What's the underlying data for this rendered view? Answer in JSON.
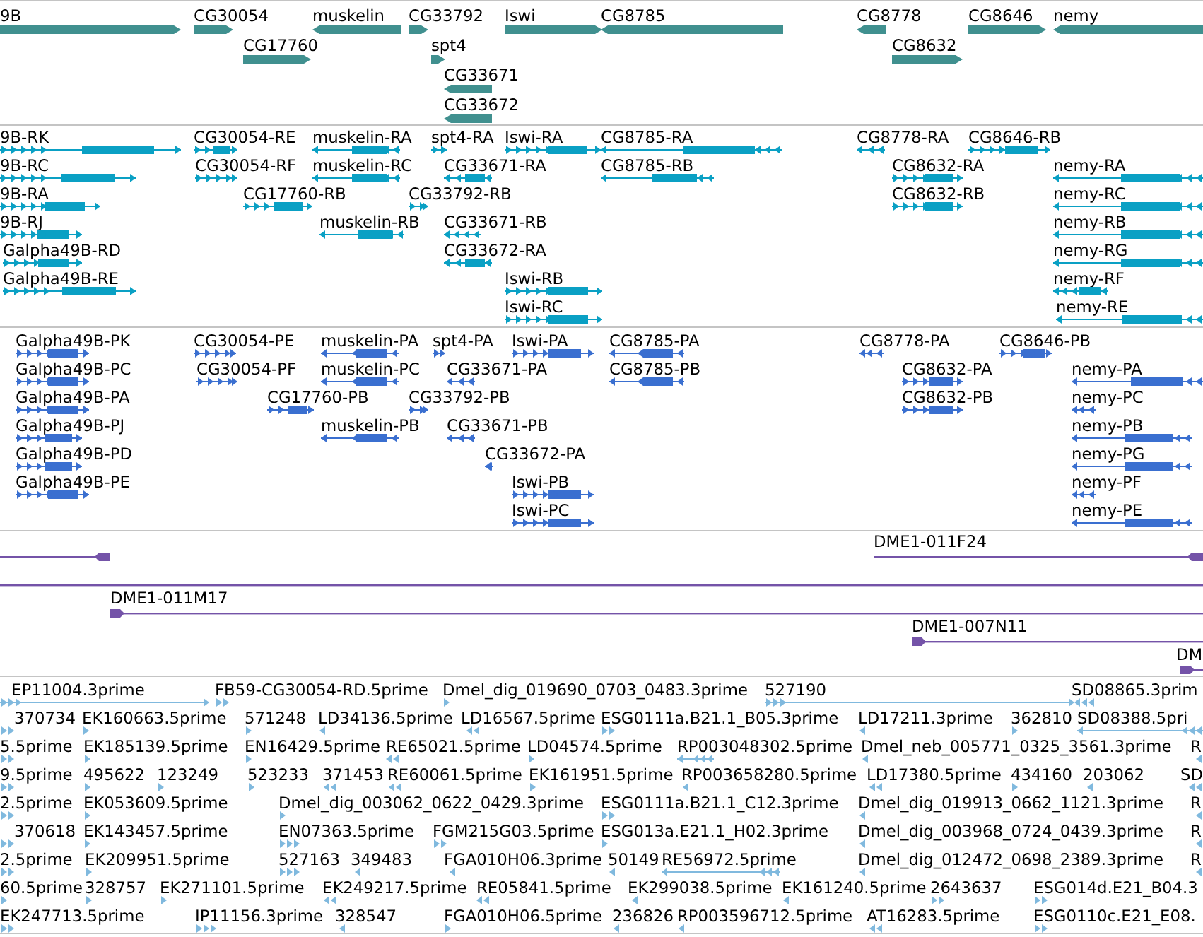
{
  "tracks": [
    {
      "kind": "gene",
      "rows": [
        {
          "features": [
            {
              "label": "9B",
              "reverse": false
            },
            {
              "label": "CG30054",
              "reverse": false
            },
            {
              "label": "muskelin",
              "reverse": true
            },
            {
              "label": "CG33792",
              "reverse": false
            },
            {
              "label": "Iswi",
              "reverse": false
            },
            {
              "label": "CG8785",
              "reverse": true
            },
            {
              "label": "CG8778",
              "reverse": true
            },
            {
              "label": "CG8646",
              "reverse": false
            },
            {
              "label": "nemy",
              "reverse": true
            }
          ]
        },
        {
          "features": [
            {
              "label": "CG17760",
              "reverse": false
            },
            {
              "label": "spt4",
              "reverse": false
            },
            {
              "label": "CG8632",
              "reverse": false
            }
          ]
        },
        {
          "features": [
            {
              "label": "CG33671",
              "reverse": true
            }
          ]
        },
        {
          "features": [
            {
              "label": "CG33672",
              "reverse": true
            }
          ]
        }
      ]
    },
    {
      "kind": "transcript",
      "rows": [
        {
          "features": [
            {
              "label": "9B-RK",
              "reverse": false
            },
            {
              "label": "CG30054-RE",
              "reverse": false
            },
            {
              "label": "muskelin-RA",
              "reverse": true
            },
            {
              "label": "spt4-RA",
              "reverse": false
            },
            {
              "label": "Iswi-RA",
              "reverse": false
            },
            {
              "label": "CG8785-RA",
              "reverse": true
            },
            {
              "label": "CG8778-RA",
              "reverse": true
            },
            {
              "label": "CG8646-RB",
              "reverse": false
            }
          ]
        },
        {
          "features": [
            {
              "label": "9B-RC",
              "reverse": false
            },
            {
              "label": "CG30054-RF",
              "reverse": false
            },
            {
              "label": "muskelin-RC",
              "reverse": true
            },
            {
              "label": "CG33671-RA",
              "reverse": true
            },
            {
              "label": "CG8785-RB",
              "reverse": true
            },
            {
              "label": "CG8632-RA",
              "reverse": false
            },
            {
              "label": "nemy-RA",
              "reverse": true
            }
          ]
        },
        {
          "features": [
            {
              "label": "9B-RA",
              "reverse": false
            },
            {
              "label": "CG17760-RB",
              "reverse": false
            },
            {
              "label": "CG33792-RB",
              "reverse": false
            },
            {
              "label": "CG8632-RB",
              "reverse": false
            },
            {
              "label": "nemy-RC",
              "reverse": true
            }
          ]
        },
        {
          "features": [
            {
              "label": "9B-RJ",
              "reverse": false
            },
            {
              "label": "muskelin-RB",
              "reverse": true
            },
            {
              "label": "CG33671-RB",
              "reverse": true
            },
            {
              "label": "nemy-RB",
              "reverse": true
            }
          ]
        },
        {
          "features": [
            {
              "label": "Galpha49B-RD",
              "reverse": false
            },
            {
              "label": "CG33672-RA",
              "reverse": true
            },
            {
              "label": "nemy-RG",
              "reverse": true
            }
          ]
        },
        {
          "features": [
            {
              "label": "Galpha49B-RE",
              "reverse": false
            },
            {
              "label": "Iswi-RB",
              "reverse": false
            },
            {
              "label": "nemy-RF",
              "reverse": true
            }
          ]
        },
        {
          "features": [
            {
              "label": "Iswi-RC",
              "reverse": false
            },
            {
              "label": "nemy-RE",
              "reverse": true
            }
          ]
        }
      ]
    },
    {
      "kind": "protein",
      "rows": [
        {
          "features": [
            {
              "label": "Galpha49B-PK",
              "reverse": false
            },
            {
              "label": "CG30054-PE",
              "reverse": false
            },
            {
              "label": "muskelin-PA",
              "reverse": true
            },
            {
              "label": "spt4-PA",
              "reverse": false
            },
            {
              "label": "Iswi-PA",
              "reverse": false
            },
            {
              "label": "CG8785-PA",
              "reverse": true
            },
            {
              "label": "CG8778-PA",
              "reverse": true
            },
            {
              "label": "CG8646-PB",
              "reverse": false
            }
          ]
        },
        {
          "features": [
            {
              "label": "Galpha49B-PC",
              "reverse": false
            },
            {
              "label": "CG30054-PF",
              "reverse": false
            },
            {
              "label": "muskelin-PC",
              "reverse": true
            },
            {
              "label": "CG33671-PA",
              "reverse": true
            },
            {
              "label": "CG8785-PB",
              "reverse": true
            },
            {
              "label": "CG8632-PA",
              "reverse": false
            },
            {
              "label": "nemy-PA",
              "reverse": true
            }
          ]
        },
        {
          "features": [
            {
              "label": "Galpha49B-PA",
              "reverse": false
            },
            {
              "label": "CG17760-PB",
              "reverse": false
            },
            {
              "label": "CG33792-PB",
              "reverse": false
            },
            {
              "label": "CG8632-PB",
              "reverse": false
            },
            {
              "label": "nemy-PC",
              "reverse": true
            }
          ]
        },
        {
          "features": [
            {
              "label": "Galpha49B-PJ",
              "reverse": false
            },
            {
              "label": "muskelin-PB",
              "reverse": true
            },
            {
              "label": "CG33671-PB",
              "reverse": true
            },
            {
              "label": "nemy-PB",
              "reverse": true
            }
          ]
        },
        {
          "features": [
            {
              "label": "Galpha49B-PD",
              "reverse": false
            },
            {
              "label": "CG33672-PA",
              "reverse": true
            },
            {
              "label": "nemy-PG",
              "reverse": true
            }
          ]
        },
        {
          "features": [
            {
              "label": "Galpha49B-PE",
              "reverse": false
            },
            {
              "label": "Iswi-PB",
              "reverse": false
            },
            {
              "label": "nemy-PF",
              "reverse": true
            }
          ]
        },
        {
          "features": [
            {
              "label": "Iswi-PC",
              "reverse": false
            },
            {
              "label": "nemy-PE",
              "reverse": true
            }
          ]
        }
      ]
    },
    {
      "kind": "clone",
      "rows": [
        {
          "features": [
            {
              "reverse": true
            },
            {
              "label": "DME1-011F24",
              "reverse": true
            }
          ]
        },
        {
          "features": [
            {
              "reverse": false
            }
          ]
        },
        {
          "features": [
            {
              "label": "DME1-011M17",
              "reverse": false
            }
          ]
        },
        {
          "features": [
            {
              "label": "DME1-007N11",
              "reverse": false
            }
          ]
        },
        {
          "features": [
            {
              "label": "DM",
              "reverse": false
            }
          ]
        }
      ]
    },
    {
      "kind": "est",
      "rows": [
        {
          "features": [
            {
              "label": "EP11004.3prime",
              "reverse": false
            },
            {
              "label": "FB59-CG30054-RD.5prime",
              "reverse": false
            },
            {
              "label": "Dmel_dig_019690_0703_0483.3prime",
              "reverse": false
            },
            {
              "label": "527190",
              "reverse": false
            },
            {
              "label": "SD08865.3prim",
              "reverse": true
            }
          ]
        },
        {
          "features": [
            {
              "label": "370734",
              "reverse": false
            },
            {
              "label": "EK160663.5prime",
              "reverse": false
            },
            {
              "label": "571248",
              "reverse": false
            },
            {
              "label": "LD34136.5prime",
              "reverse": true
            },
            {
              "label": "LD16567.5prime",
              "reverse": true
            },
            {
              "label": "ESG0111a.B21.1_B05.3prime",
              "reverse": false
            },
            {
              "label": "LD17211.3prime",
              "reverse": true
            },
            {
              "label": "362810",
              "reverse": false
            },
            {
              "label": "SD08388.5pri",
              "reverse": true
            }
          ]
        },
        {
          "features": [
            {
              "label": "5.5prime",
              "reverse": false
            },
            {
              "label": "EK185139.5prime",
              "reverse": false
            },
            {
              "label": "EN16429.5prime",
              "reverse": false
            },
            {
              "label": "RE65021.5prime",
              "reverse": true
            },
            {
              "label": "LD04574.5prime",
              "reverse": false
            },
            {
              "label": "RP003048302.5prime",
              "reverse": true
            },
            {
              "label": "Dmel_neb_005771_0325_3561.3prime",
              "reverse": true
            },
            {
              "label": "R",
              "reverse": true
            }
          ]
        },
        {
          "features": [
            {
              "label": "9.5prime",
              "reverse": false
            },
            {
              "label": "495622",
              "reverse": false
            },
            {
              "label": "123249",
              "reverse": false
            },
            {
              "label": "523233",
              "reverse": false
            },
            {
              "label": "371453",
              "reverse": true
            },
            {
              "label": "RE60061.5prime",
              "reverse": true
            },
            {
              "label": "EK161951.5prime",
              "reverse": false
            },
            {
              "label": "RP003658280.5prime",
              "reverse": true
            },
            {
              "label": "LD17380.5prime",
              "reverse": true
            },
            {
              "label": "434160",
              "reverse": false
            },
            {
              "label": "203062",
              "reverse": true
            },
            {
              "label": "SD",
              "reverse": true
            }
          ]
        },
        {
          "features": [
            {
              "label": "2.5prime",
              "reverse": false
            },
            {
              "label": "EK053609.5prime",
              "reverse": false
            },
            {
              "label": "Dmel_dig_003062_0622_0429.3prime",
              "reverse": false
            },
            {
              "label": "ESG0111a.B21.1_C12.3prime",
              "reverse": false
            },
            {
              "label": "Dmel_dig_019913_0662_1121.3prime",
              "reverse": true
            },
            {
              "label": "R",
              "reverse": true
            }
          ]
        },
        {
          "features": [
            {
              "label": "370618",
              "reverse": false
            },
            {
              "label": "EK143457.5prime",
              "reverse": false
            },
            {
              "label": "EN07363.5prime",
              "reverse": false
            },
            {
              "label": "FGM215G03.5prime",
              "reverse": false
            },
            {
              "label": "ESG013a.E21.1_H02.3prime",
              "reverse": false
            },
            {
              "label": "Dmel_dig_003968_0724_0439.3prime",
              "reverse": true
            },
            {
              "label": "R",
              "reverse": true
            }
          ]
        },
        {
          "features": [
            {
              "label": "2.5prime",
              "reverse": false
            },
            {
              "label": "EK209951.5prime",
              "reverse": false
            },
            {
              "label": "527163",
              "reverse": false
            },
            {
              "label": "349483",
              "reverse": true
            },
            {
              "label": "FGA010H06.3prime",
              "reverse": true
            },
            {
              "label": "50149",
              "reverse": true
            },
            {
              "label": "RE56972.5prime",
              "reverse": true
            },
            {
              "label": "Dmel_dig_012472_0698_2389.3prime",
              "reverse": true
            },
            {
              "label": "R",
              "reverse": true
            }
          ]
        },
        {
          "features": [
            {
              "label": "60.5prime",
              "reverse": false
            },
            {
              "label": "328757",
              "reverse": false
            },
            {
              "label": "EK271101.5prime",
              "reverse": false
            },
            {
              "label": "EK249217.5prime",
              "reverse": true
            },
            {
              "label": "RE05841.5prime",
              "reverse": true
            },
            {
              "label": "EK299038.5prime",
              "reverse": true
            },
            {
              "label": "EK161240.5prime",
              "reverse": true
            },
            {
              "label": "2643637",
              "reverse": false
            },
            {
              "label": "ESG014d.E21_B04.3",
              "reverse": false
            }
          ]
        },
        {
          "features": [
            {
              "label": "EK247713.5prime",
              "reverse": false
            },
            {
              "label": "IP11156.3prime",
              "reverse": false
            },
            {
              "label": "328547",
              "reverse": true
            },
            {
              "label": "FGA010H06.5prime",
              "reverse": false
            },
            {
              "label": "236826",
              "reverse": true
            },
            {
              "label": "RP003596712.5prime",
              "reverse": true
            },
            {
              "label": "AT16283.5prime",
              "reverse": true
            },
            {
              "label": "ESG0110c.E21_E08.",
              "reverse": false
            }
          ]
        }
      ]
    }
  ]
}
